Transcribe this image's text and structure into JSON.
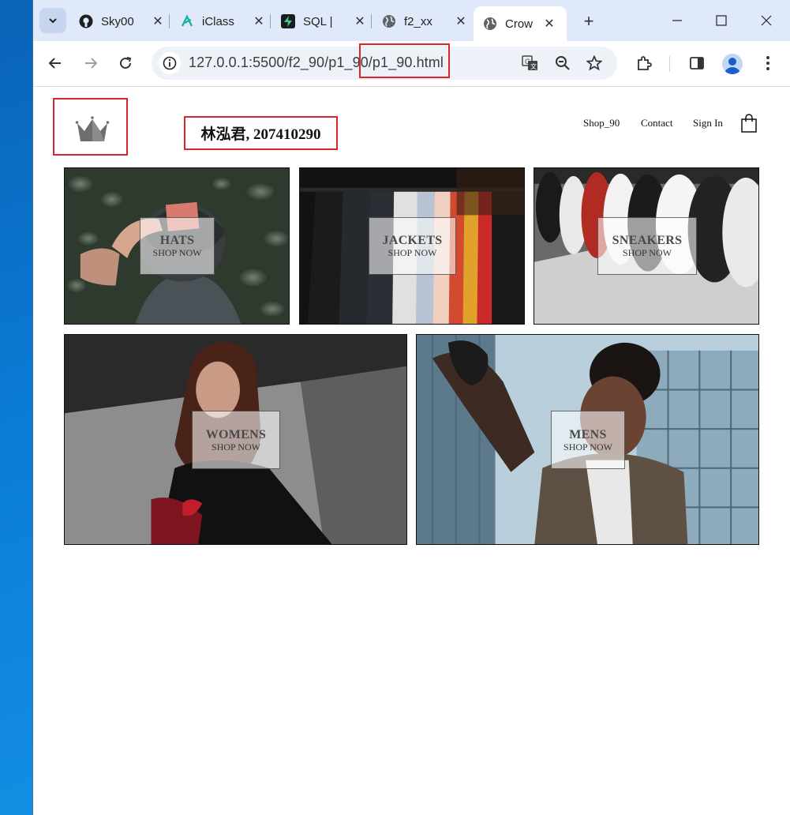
{
  "browser": {
    "tabs": [
      {
        "title": "Sky00",
        "icon": "github-icon"
      },
      {
        "title": "iClass",
        "icon": "iclass-icon"
      },
      {
        "title": "SQL |",
        "icon": "supabase-icon"
      },
      {
        "title": "f2_xx",
        "icon": "globe-icon"
      },
      {
        "title": "Crow",
        "icon": "globe-icon",
        "active": true
      }
    ],
    "close_glyph": "✕",
    "new_tab_glyph": "+",
    "url": "127.0.0.1:5500/f2_90/p1_90/p1_90.html"
  },
  "site": {
    "student": "林泓君, 207410290",
    "nav": {
      "shop": "Shop_90",
      "contact": "Contact",
      "signin": "Sign In"
    },
    "categories": [
      {
        "title": "HATS",
        "subtitle": "SHOP NOW"
      },
      {
        "title": "JACKETS",
        "subtitle": "SHOP NOW"
      },
      {
        "title": "SNEAKERS",
        "subtitle": "SHOP NOW"
      },
      {
        "title": "WOMENS",
        "subtitle": "SHOP NOW"
      },
      {
        "title": "MENS",
        "subtitle": "SHOP NOW"
      }
    ]
  },
  "colors": {
    "annotation": "#d8262c",
    "tabstrip": "#dfe9f9",
    "accent": "#1a73e8"
  }
}
